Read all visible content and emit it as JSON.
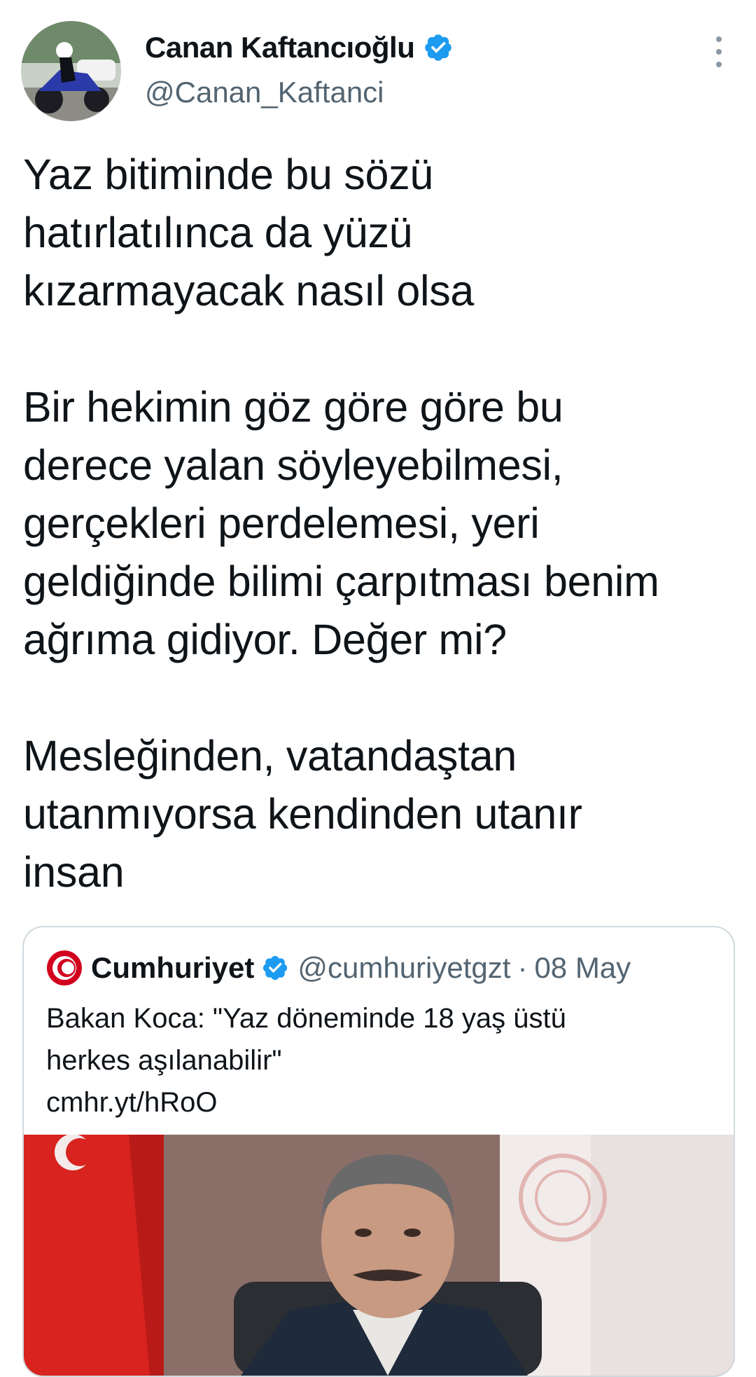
{
  "author": {
    "display_name": "Canan Kaftancıoğlu",
    "handle": "@Canan_Kaftanci",
    "avatar_icon": "avatar-motorcycle-photo",
    "verified_icon": "verified-badge-icon",
    "more_icon": "more-vertical-icon"
  },
  "tweet": {
    "paragraphs": [
      "Yaz bitiminde bu sözü\nhatırlatılınca da yüzü\nkızarmayacak nasıl olsa",
      "Bir hekimin göz göre göre bu\nderece yalan söyleyebilmesi,\ngerçekleri perdelemesi, yeri\ngeldiğinde bilimi çarpıtması benim\nağrıma gidiyor. Değer mi?",
      "Mesleğinden, vatandaştan\nutanmıyorsa kendinden utanır\ninsan"
    ]
  },
  "quote": {
    "display_name": "Cumhuriyet",
    "handle": "@cumhuriyetgzt",
    "separator": "·",
    "date": "08 May",
    "logo_icon": "cumhuriyet-logo-icon",
    "text_lines": [
      "Bakan Koca: \"Yaz döneminde 18 yaş üstü",
      "herkes aşılanabilir\""
    ],
    "link": "cmhr.yt/hRoO",
    "image_icon": "news-photo"
  },
  "colors": {
    "text": "#0f1419",
    "secondary": "#536471",
    "verified": "#1d9bf0",
    "border": "#cfd9de",
    "cumhuriyet_red": "#d2001e"
  }
}
